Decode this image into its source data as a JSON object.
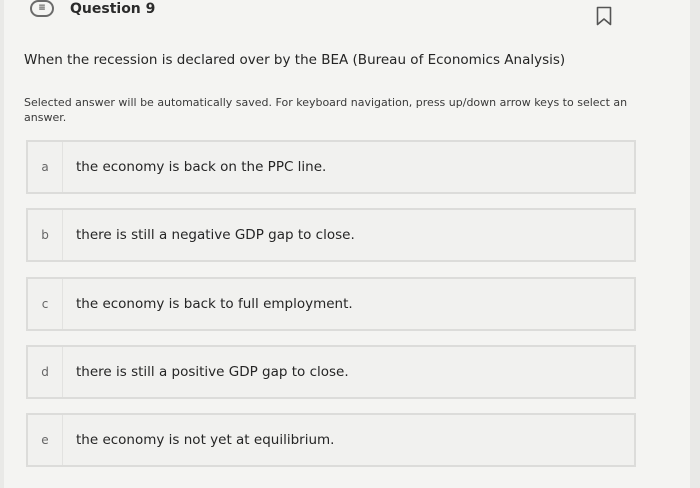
{
  "header": {
    "icon": "question-list-icon",
    "title": "Question 9",
    "bookmark_icon": "bookmark-flag-icon"
  },
  "question": {
    "prompt": "When the recession is declared over by the BEA (Bureau of Economics Analysis)",
    "instructions": "Selected answer will be automatically saved. For keyboard navigation, press up/down arrow keys to select an answer."
  },
  "options": [
    {
      "letter": "a",
      "text": "the economy is back on the PPC line."
    },
    {
      "letter": "b",
      "text": "there is still a negative GDP gap to close."
    },
    {
      "letter": "c",
      "text": "the economy is back to full employment."
    },
    {
      "letter": "d",
      "text": "there is still a positive GDP gap to close."
    },
    {
      "letter": "e",
      "text": "the economy is not yet at equilibrium."
    }
  ]
}
